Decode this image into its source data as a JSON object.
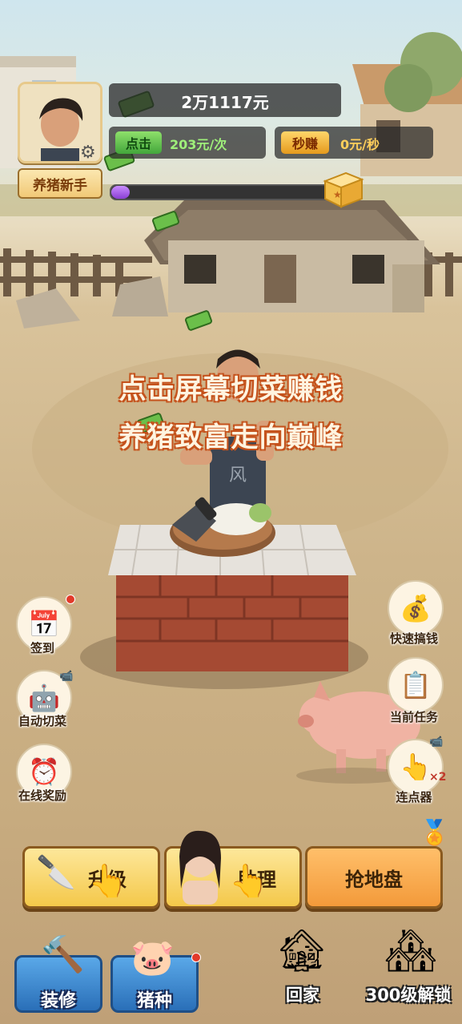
{
  "player": {
    "money": "2万1117元",
    "level_title": "养猪新手",
    "click_tag": "点击",
    "click_value": "203元/次",
    "second_tag": "秒赚",
    "second_value": "0元/秒",
    "progress_fraction": 0.08
  },
  "headline": {
    "line1": "点击屏幕切菜赚钱",
    "line2": "养猪致富走向巅峰"
  },
  "left_buttons": [
    {
      "label": "签到",
      "icon": "calendar-check-icon"
    },
    {
      "label": "自动切菜",
      "icon": "robot-chef-icon"
    },
    {
      "label": "在线奖励",
      "icon": "alarm-clock-icon"
    }
  ],
  "right_buttons": [
    {
      "label": "快速搞钱",
      "icon": "money-bag-icon"
    },
    {
      "label": "当前任务",
      "icon": "clipboard-icon"
    },
    {
      "label": "连点器",
      "icon": "tap-hand-icon",
      "badge": "×2"
    }
  ],
  "actions": {
    "upgrade": "升级",
    "assistant": "助理",
    "grab_land": "抢地盘"
  },
  "nav": {
    "decorate": "装修",
    "pig_breed": "猪种",
    "home": "回家",
    "unlock": "300级解锁"
  },
  "colors": {
    "headline_outline": "#c5531d",
    "nav_blue": "#2a6fb8",
    "action_yellow": "#f6d35a",
    "action_orange": "#f39a3a"
  }
}
